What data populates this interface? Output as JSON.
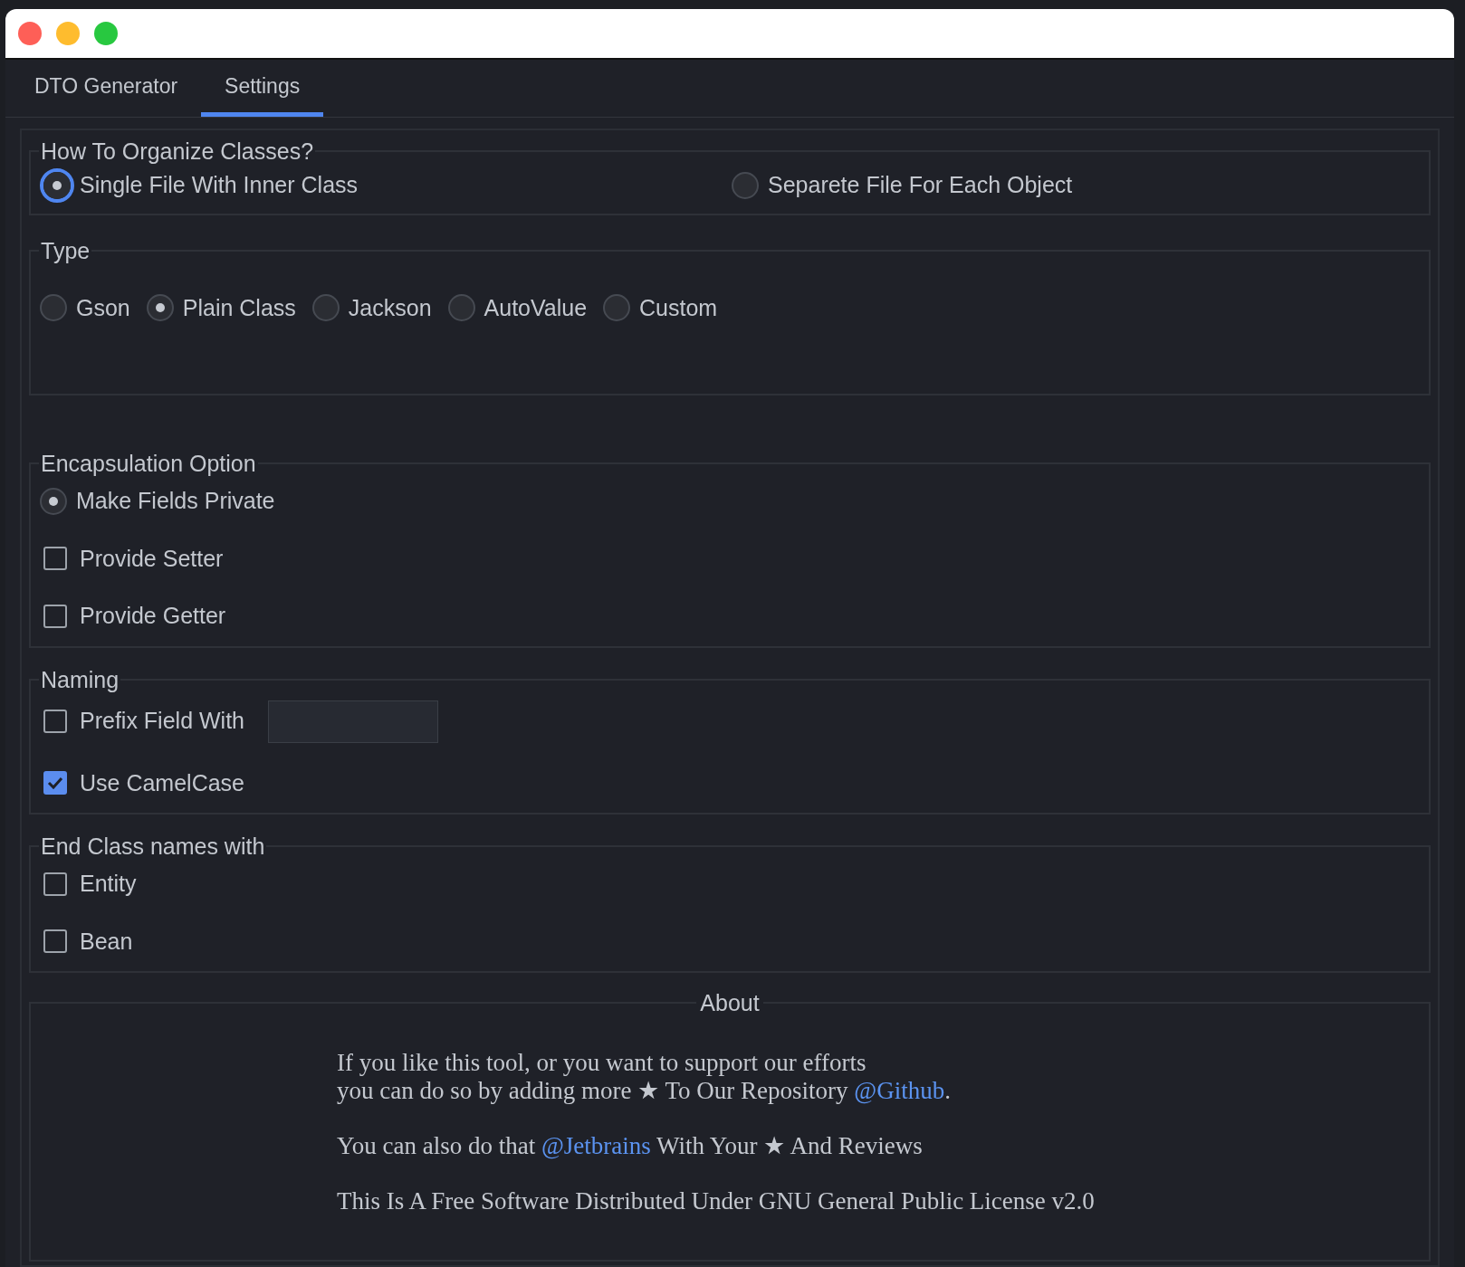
{
  "tabs": [
    {
      "label": "DTO Generator",
      "selected": false
    },
    {
      "label": "Settings",
      "selected": true
    }
  ],
  "groups": [
    {
      "title": "How To Organize Classes?",
      "items": [
        {
          "kind": "radio",
          "label": "Single File With Inner Class",
          "selected": true,
          "focused": true
        },
        {
          "kind": "radio",
          "label": "Separete File For Each Object",
          "selected": false,
          "focused": false
        }
      ]
    },
    {
      "title": "Type",
      "items": [
        {
          "kind": "radio",
          "label": "Gson",
          "selected": false,
          "focused": false
        },
        {
          "kind": "radio",
          "label": "Plain Class",
          "selected": true,
          "focused": false
        },
        {
          "kind": "radio",
          "label": "Jackson",
          "selected": false,
          "focused": false
        },
        {
          "kind": "radio",
          "label": "AutoValue",
          "selected": false,
          "focused": false
        },
        {
          "kind": "radio",
          "label": "Custom",
          "selected": false,
          "focused": false
        }
      ]
    },
    {
      "title": "Encapsulation Option",
      "items": [
        {
          "kind": "radio",
          "label": "Make Fields Private",
          "selected": true,
          "focused": false
        },
        {
          "kind": "checkbox",
          "label": "Provide Setter",
          "checked": false
        },
        {
          "kind": "checkbox",
          "label": "Provide Getter",
          "checked": false
        }
      ]
    },
    {
      "title": "Naming",
      "items": [
        {
          "kind": "checkbox-field",
          "label": "Prefix Field With",
          "checked": false
        },
        {
          "kind": "checkbox",
          "label": "Use CamelCase",
          "checked": true
        }
      ]
    },
    {
      "title": "End Class names with",
      "items": [
        {
          "kind": "checkbox",
          "label": "Entity",
          "checked": false
        },
        {
          "kind": "checkbox",
          "label": "Bean",
          "checked": false
        }
      ]
    }
  ],
  "about": {
    "title": "About",
    "paragraphs": [
      {
        "segments": [
          {
            "kind": "text",
            "text": "If you like this tool, or you want to support our efforts"
          },
          {
            "kind": "break"
          },
          {
            "kind": "text",
            "text": "you can do so by adding more ★ To Our Repository "
          },
          {
            "kind": "link",
            "text": "@Github"
          },
          {
            "kind": "text",
            "text": "."
          }
        ]
      },
      {
        "segments": [
          {
            "kind": "text",
            "text": "You can also do that "
          },
          {
            "kind": "link",
            "text": "@Jetbrains"
          },
          {
            "kind": "text",
            "text": " With Your ★ And Reviews"
          }
        ]
      },
      {
        "segments": [
          {
            "kind": "text",
            "text": "This Is A Free Software Distributed Under GNU General Public License v2.0"
          }
        ]
      }
    ]
  }
}
